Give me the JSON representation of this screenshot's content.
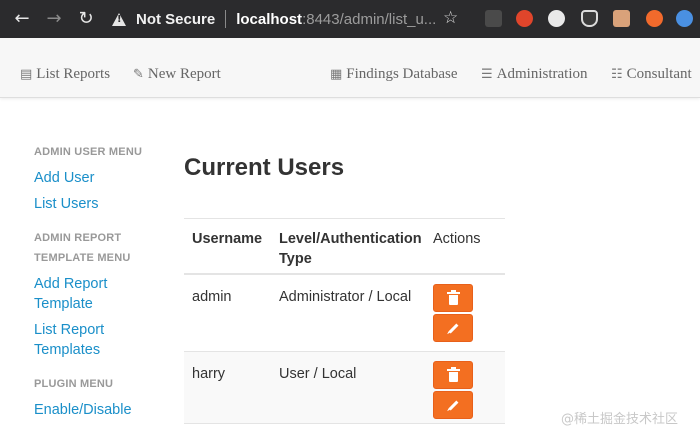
{
  "browser": {
    "security_label": "Not Secure",
    "url_host": "localhost",
    "url_rest": ":8443/admin/list_u..."
  },
  "navbar": {
    "items": [
      {
        "label": "List Reports",
        "icon": "document-icon"
      },
      {
        "label": "New Report",
        "icon": "edit-icon"
      },
      {
        "label": "Findings Database",
        "icon": "sitemap-icon"
      },
      {
        "label": "Administration",
        "icon": "list-icon"
      },
      {
        "label": "Consultant",
        "icon": "id-card-icon"
      }
    ]
  },
  "sidebar": {
    "admin_user_menu": "ADMIN USER MENU",
    "add_user": "Add User",
    "list_users": "List Users",
    "admin_report_menu": "ADMIN REPORT",
    "admin_report_menu2": "TEMPLATE MENU",
    "add_report_template_1": "Add Report",
    "add_report_template_2": "Template",
    "list_report_templates_1": "List Report",
    "list_report_templates_2": "Templates",
    "plugin_menu": "PLUGIN MENU",
    "enable_disable": "Enable/Disable"
  },
  "main": {
    "title": "Current Users",
    "columns": [
      "Username",
      "Level/Authentication",
      "Type",
      "Actions"
    ],
    "rows": [
      {
        "username": "admin",
        "level": "Administrator / Local"
      },
      {
        "username": "harry",
        "level": "User / Local"
      }
    ]
  },
  "watermark": "@稀土掘金技术社区",
  "colors": {
    "accent": "#f36f21",
    "link": "#1a8fc9",
    "browser_bar": "#2b2b2d"
  }
}
